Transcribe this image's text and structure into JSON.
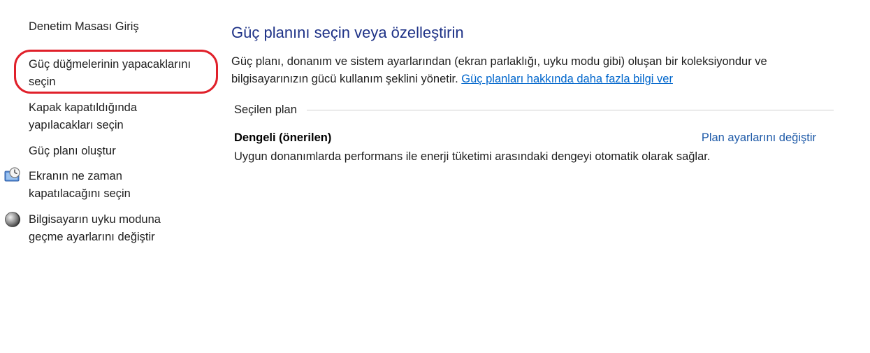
{
  "nav": {
    "home": "Denetim Masası Giriş",
    "power_buttons": [
      "Güç düğmelerinin yapacaklarını",
      "seçin"
    ],
    "lid": [
      "Kapak kapatıldığında",
      "yapılacakları seçin"
    ],
    "create_plan": "Güç planı oluştur",
    "display": [
      "Ekranın ne zaman",
      "kapatılacağını seçin"
    ],
    "sleep": [
      "Bilgisayarın uyku moduna",
      "geçme ayarlarını değiştir"
    ],
    "highlight_color": "#e0202a"
  },
  "main": {
    "title": "Güç planını seçin veya özelleştirin",
    "description": "Güç planı, donanım ve sistem ayarlarından (ekran parlaklığı, uyku modu gibi) oluşan bir koleksiyondur ve bilgisayarınızın gücü kullanım şeklini yönetir.",
    "learn_more_link": "Güç planları hakkında daha fazla bilgi ver",
    "selected_plan_label": "Seçilen plan",
    "plan": {
      "name": "Dengeli (önerilen)",
      "settings_link": "Plan ayarlarını değiştir",
      "description": "Uygun donanımlarda performans ile enerji tüketimi arasındaki dengeyi otomatik olarak sağlar."
    },
    "title_color": "#1e3287",
    "link_color": "#0066cc"
  },
  "icons": {
    "display": "clock-display-icon",
    "sleep": "moon-sleep-icon"
  }
}
